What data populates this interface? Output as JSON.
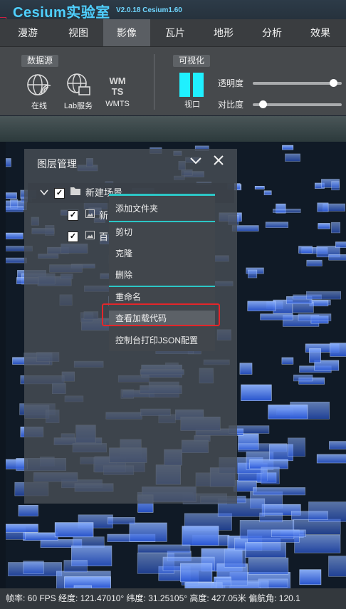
{
  "app": {
    "title": "Cesium实验室",
    "version": "V2.0.18  Cesium1.60"
  },
  "tabs": [
    {
      "label": "漫游"
    },
    {
      "label": "视图"
    },
    {
      "label": "影像"
    },
    {
      "label": "瓦片"
    },
    {
      "label": "地形"
    },
    {
      "label": "分析"
    },
    {
      "label": "效果"
    }
  ],
  "active_tab": "影像",
  "ribbon": {
    "datasource_label": "数据源",
    "online_label": "在线",
    "lab_service_label": "Lab服务",
    "wmts_label": "WMTS",
    "visualization_label": "可视化",
    "viewport_label": "视口",
    "opacity_label": "透明度",
    "contrast_label": "对比度",
    "opacity_value": 0.95,
    "contrast_value": 0.08,
    "wmts_icon_text": "WM TS",
    "colors": {
      "viewport": "#1ff0ff",
      "accent": "#2cc6c6",
      "title": "#4fd0ff"
    }
  },
  "layer_panel": {
    "title": "图层管理",
    "root": {
      "label": "新建场景",
      "checked": true
    },
    "children": [
      {
        "label": "新",
        "checked": true
      },
      {
        "label": "百",
        "checked": true
      }
    ]
  },
  "context_menu": {
    "items": [
      {
        "label": "添加文件夹"
      },
      {
        "label": "剪切"
      },
      {
        "label": "克隆"
      },
      {
        "label": "删除"
      },
      {
        "label": "重命名"
      },
      {
        "label": "查看加载代码"
      },
      {
        "label": "控制台打印JSON配置"
      }
    ],
    "highlight_color": "#e3262a"
  },
  "status": {
    "text": "帧率: 60 FPS 经度: 121.47010° 纬度: 31.25105° 高度: 427.05米 偏航角: 120.1"
  }
}
